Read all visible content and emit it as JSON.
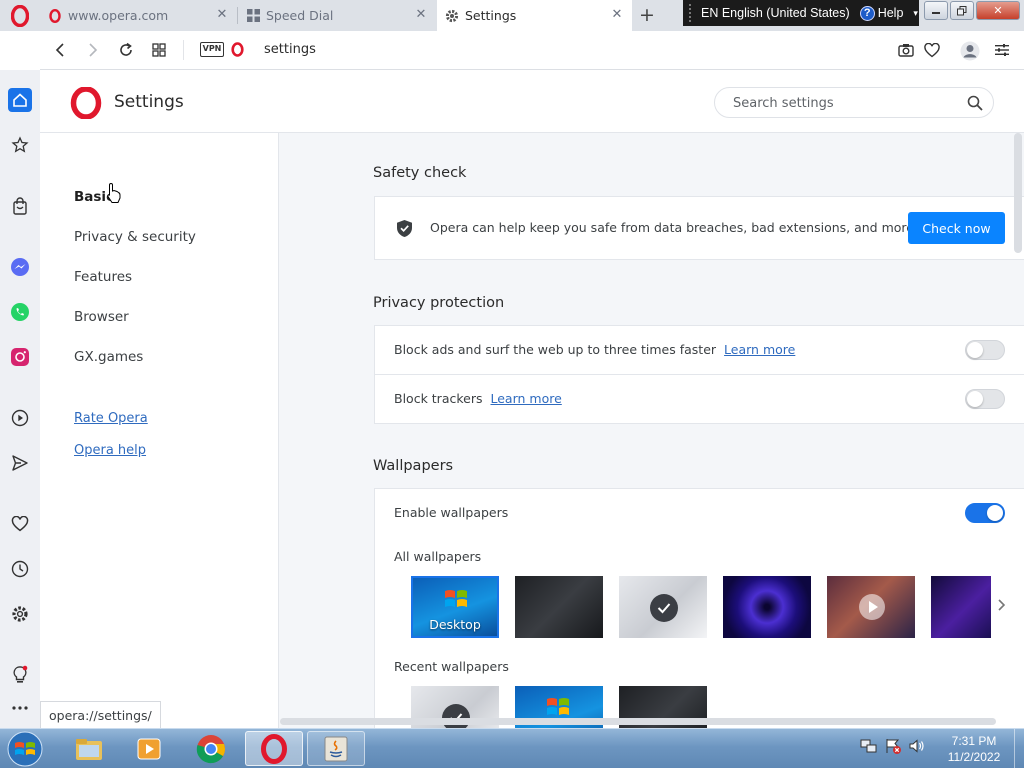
{
  "browser": {
    "tabs": [
      {
        "title": "www.opera.com",
        "favicon": "opera-icon"
      },
      {
        "title": "Speed Dial",
        "favicon": "grid-icon"
      },
      {
        "title": "Settings",
        "favicon": "gear-icon",
        "active": true
      }
    ],
    "new_tab_label": "+",
    "url": "settings",
    "vpn_label": "VPN"
  },
  "language_bar": {
    "language": "EN English (United States)",
    "help_label": "Help"
  },
  "settings": {
    "title": "Settings",
    "search_placeholder": "Search settings",
    "nav": [
      "Basic",
      "Privacy & security",
      "Features",
      "Browser",
      "GX.games"
    ],
    "links": [
      "Rate Opera",
      "Opera help"
    ],
    "safety_check": {
      "title": "Safety check",
      "text": "Opera can help keep you safe from data breaches, bad extensions, and more",
      "button": "Check now"
    },
    "privacy_protection": {
      "title": "Privacy protection",
      "rows": [
        {
          "text": "Block ads and surf the web up to three times faster",
          "link": "Learn more",
          "enabled": false
        },
        {
          "text": "Block trackers",
          "link": "Learn more",
          "enabled": false
        }
      ]
    },
    "wallpapers": {
      "title": "Wallpapers",
      "enable_label": "Enable wallpapers",
      "enabled": true,
      "all_label": "All wallpapers",
      "recent_label": "Recent wallpapers",
      "desktop_label": "Desktop"
    }
  },
  "status_tooltip": "opera://settings/",
  "taskbar": {
    "time": "7:31 PM",
    "date": "11/2/2022"
  },
  "colors": {
    "accent": "#0a84ff",
    "opera_red": "#e0182d",
    "link": "#2f6bbf"
  }
}
